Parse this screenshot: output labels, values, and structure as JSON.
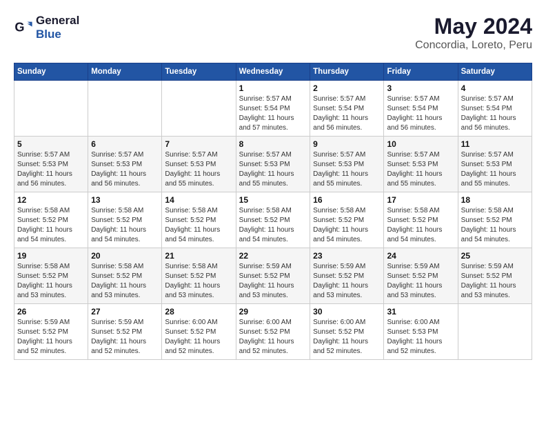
{
  "logo": {
    "line1": "General",
    "line2": "Blue"
  },
  "title": "May 2024",
  "subtitle": "Concordia, Loreto, Peru",
  "weekdays": [
    "Sunday",
    "Monday",
    "Tuesday",
    "Wednesday",
    "Thursday",
    "Friday",
    "Saturday"
  ],
  "weeks": [
    [
      {
        "day": "",
        "sunrise": "",
        "sunset": "",
        "daylight": ""
      },
      {
        "day": "",
        "sunrise": "",
        "sunset": "",
        "daylight": ""
      },
      {
        "day": "",
        "sunrise": "",
        "sunset": "",
        "daylight": ""
      },
      {
        "day": "1",
        "sunrise": "5:57 AM",
        "sunset": "5:54 PM",
        "daylight": "11 hours and 57 minutes."
      },
      {
        "day": "2",
        "sunrise": "5:57 AM",
        "sunset": "5:54 PM",
        "daylight": "11 hours and 56 minutes."
      },
      {
        "day": "3",
        "sunrise": "5:57 AM",
        "sunset": "5:54 PM",
        "daylight": "11 hours and 56 minutes."
      },
      {
        "day": "4",
        "sunrise": "5:57 AM",
        "sunset": "5:54 PM",
        "daylight": "11 hours and 56 minutes."
      }
    ],
    [
      {
        "day": "5",
        "sunrise": "5:57 AM",
        "sunset": "5:53 PM",
        "daylight": "11 hours and 56 minutes."
      },
      {
        "day": "6",
        "sunrise": "5:57 AM",
        "sunset": "5:53 PM",
        "daylight": "11 hours and 56 minutes."
      },
      {
        "day": "7",
        "sunrise": "5:57 AM",
        "sunset": "5:53 PM",
        "daylight": "11 hours and 55 minutes."
      },
      {
        "day": "8",
        "sunrise": "5:57 AM",
        "sunset": "5:53 PM",
        "daylight": "11 hours and 55 minutes."
      },
      {
        "day": "9",
        "sunrise": "5:57 AM",
        "sunset": "5:53 PM",
        "daylight": "11 hours and 55 minutes."
      },
      {
        "day": "10",
        "sunrise": "5:57 AM",
        "sunset": "5:53 PM",
        "daylight": "11 hours and 55 minutes."
      },
      {
        "day": "11",
        "sunrise": "5:57 AM",
        "sunset": "5:53 PM",
        "daylight": "11 hours and 55 minutes."
      }
    ],
    [
      {
        "day": "12",
        "sunrise": "5:58 AM",
        "sunset": "5:52 PM",
        "daylight": "11 hours and 54 minutes."
      },
      {
        "day": "13",
        "sunrise": "5:58 AM",
        "sunset": "5:52 PM",
        "daylight": "11 hours and 54 minutes."
      },
      {
        "day": "14",
        "sunrise": "5:58 AM",
        "sunset": "5:52 PM",
        "daylight": "11 hours and 54 minutes."
      },
      {
        "day": "15",
        "sunrise": "5:58 AM",
        "sunset": "5:52 PM",
        "daylight": "11 hours and 54 minutes."
      },
      {
        "day": "16",
        "sunrise": "5:58 AM",
        "sunset": "5:52 PM",
        "daylight": "11 hours and 54 minutes."
      },
      {
        "day": "17",
        "sunrise": "5:58 AM",
        "sunset": "5:52 PM",
        "daylight": "11 hours and 54 minutes."
      },
      {
        "day": "18",
        "sunrise": "5:58 AM",
        "sunset": "5:52 PM",
        "daylight": "11 hours and 54 minutes."
      }
    ],
    [
      {
        "day": "19",
        "sunrise": "5:58 AM",
        "sunset": "5:52 PM",
        "daylight": "11 hours and 53 minutes."
      },
      {
        "day": "20",
        "sunrise": "5:58 AM",
        "sunset": "5:52 PM",
        "daylight": "11 hours and 53 minutes."
      },
      {
        "day": "21",
        "sunrise": "5:58 AM",
        "sunset": "5:52 PM",
        "daylight": "11 hours and 53 minutes."
      },
      {
        "day": "22",
        "sunrise": "5:59 AM",
        "sunset": "5:52 PM",
        "daylight": "11 hours and 53 minutes."
      },
      {
        "day": "23",
        "sunrise": "5:59 AM",
        "sunset": "5:52 PM",
        "daylight": "11 hours and 53 minutes."
      },
      {
        "day": "24",
        "sunrise": "5:59 AM",
        "sunset": "5:52 PM",
        "daylight": "11 hours and 53 minutes."
      },
      {
        "day": "25",
        "sunrise": "5:59 AM",
        "sunset": "5:52 PM",
        "daylight": "11 hours and 53 minutes."
      }
    ],
    [
      {
        "day": "26",
        "sunrise": "5:59 AM",
        "sunset": "5:52 PM",
        "daylight": "11 hours and 52 minutes."
      },
      {
        "day": "27",
        "sunrise": "5:59 AM",
        "sunset": "5:52 PM",
        "daylight": "11 hours and 52 minutes."
      },
      {
        "day": "28",
        "sunrise": "6:00 AM",
        "sunset": "5:52 PM",
        "daylight": "11 hours and 52 minutes."
      },
      {
        "day": "29",
        "sunrise": "6:00 AM",
        "sunset": "5:52 PM",
        "daylight": "11 hours and 52 minutes."
      },
      {
        "day": "30",
        "sunrise": "6:00 AM",
        "sunset": "5:52 PM",
        "daylight": "11 hours and 52 minutes."
      },
      {
        "day": "31",
        "sunrise": "6:00 AM",
        "sunset": "5:53 PM",
        "daylight": "11 hours and 52 minutes."
      },
      {
        "day": "",
        "sunrise": "",
        "sunset": "",
        "daylight": ""
      }
    ]
  ]
}
